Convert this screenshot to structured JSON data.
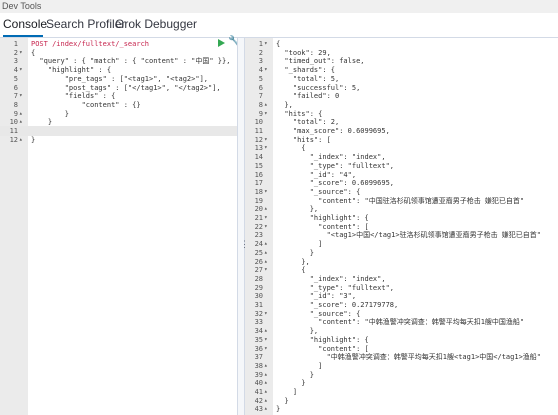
{
  "app": {
    "title": "Dev Tools"
  },
  "tabs": [
    {
      "label": "Console",
      "active": true
    },
    {
      "label": "Search Profiler",
      "active": false
    },
    {
      "label": "Grok Debugger",
      "active": false
    }
  ],
  "request": {
    "lines": [
      {
        "n": "1",
        "fold": "",
        "text": "POST /index/fulltext/_search",
        "method": true
      },
      {
        "n": "2",
        "fold": "▾",
        "text": "{"
      },
      {
        "n": "3",
        "fold": "",
        "text": "  \"query\" : { \"match\" : { \"content\" : \"中国\" }},"
      },
      {
        "n": "4",
        "fold": "▾",
        "text": "    \"highlight\" : {"
      },
      {
        "n": "5",
        "fold": "",
        "text": "        \"pre_tags\" : [\"<tag1>\", \"<tag2>\"],"
      },
      {
        "n": "6",
        "fold": "",
        "text": "        \"post_tags\" : [\"</tag1>\", \"</tag2>\"],"
      },
      {
        "n": "7",
        "fold": "▾",
        "text": "        \"fields\" : {"
      },
      {
        "n": "8",
        "fold": "",
        "text": "            \"content\" : {}"
      },
      {
        "n": "9",
        "fold": "▴",
        "text": "        }"
      },
      {
        "n": "10",
        "fold": "▴",
        "text": "    }"
      },
      {
        "n": "11",
        "fold": "",
        "text": "",
        "highlight": true
      },
      {
        "n": "12",
        "fold": "▴",
        "text": "}"
      }
    ]
  },
  "response": {
    "lines": [
      {
        "n": "1",
        "fold": "▾",
        "text": "{"
      },
      {
        "n": "2",
        "fold": "",
        "text": "  \"took\": 29,"
      },
      {
        "n": "3",
        "fold": "",
        "text": "  \"timed_out\": false,"
      },
      {
        "n": "4",
        "fold": "▾",
        "text": "  \"_shards\": {"
      },
      {
        "n": "5",
        "fold": "",
        "text": "    \"total\": 5,"
      },
      {
        "n": "6",
        "fold": "",
        "text": "    \"successful\": 5,"
      },
      {
        "n": "7",
        "fold": "",
        "text": "    \"failed\": 0"
      },
      {
        "n": "8",
        "fold": "▴",
        "text": "  },"
      },
      {
        "n": "9",
        "fold": "▾",
        "text": "  \"hits\": {"
      },
      {
        "n": "10",
        "fold": "",
        "text": "    \"total\": 2,"
      },
      {
        "n": "11",
        "fold": "",
        "text": "    \"max_score\": 0.6099695,"
      },
      {
        "n": "12",
        "fold": "▾",
        "text": "    \"hits\": ["
      },
      {
        "n": "13",
        "fold": "▾",
        "text": "      {"
      },
      {
        "n": "14",
        "fold": "",
        "text": "        \"_index\": \"index\","
      },
      {
        "n": "15",
        "fold": "",
        "text": "        \"_type\": \"fulltext\","
      },
      {
        "n": "16",
        "fold": "",
        "text": "        \"_id\": \"4\","
      },
      {
        "n": "17",
        "fold": "",
        "text": "        \"_score\": 0.6099695,"
      },
      {
        "n": "18",
        "fold": "▾",
        "text": "        \"_source\": {"
      },
      {
        "n": "19",
        "fold": "",
        "text": "          \"content\": \"中国驻洛杉矶领事馆遭亚裔男子枪击 嫌犯已自首\""
      },
      {
        "n": "20",
        "fold": "▴",
        "text": "        },"
      },
      {
        "n": "21",
        "fold": "▾",
        "text": "        \"highlight\": {"
      },
      {
        "n": "22",
        "fold": "▾",
        "text": "          \"content\": ["
      },
      {
        "n": "23",
        "fold": "",
        "text": "            \"<tag1>中国</tag1>驻洛杉矶领事馆遭亚裔男子枪击 嫌犯已自首\""
      },
      {
        "n": "24",
        "fold": "▴",
        "text": "          ]"
      },
      {
        "n": "25",
        "fold": "▴",
        "text": "        }"
      },
      {
        "n": "26",
        "fold": "▴",
        "text": "      },"
      },
      {
        "n": "27",
        "fold": "▾",
        "text": "      {"
      },
      {
        "n": "28",
        "fold": "",
        "text": "        \"_index\": \"index\","
      },
      {
        "n": "29",
        "fold": "",
        "text": "        \"_type\": \"fulltext\","
      },
      {
        "n": "30",
        "fold": "",
        "text": "        \"_id\": \"3\","
      },
      {
        "n": "31",
        "fold": "",
        "text": "        \"_score\": 0.27179778,"
      },
      {
        "n": "32",
        "fold": "▾",
        "text": "        \"_source\": {"
      },
      {
        "n": "33",
        "fold": "",
        "text": "          \"content\": \"中韩渔警冲突调查：韩警平均每天扣1艘中国渔船\""
      },
      {
        "n": "34",
        "fold": "▴",
        "text": "        },"
      },
      {
        "n": "35",
        "fold": "▾",
        "text": "        \"highlight\": {"
      },
      {
        "n": "36",
        "fold": "▾",
        "text": "          \"content\": ["
      },
      {
        "n": "37",
        "fold": "",
        "text": "            \"中韩渔警冲突调查：韩警平均每天扣1艘<tag1>中国</tag1>渔船\""
      },
      {
        "n": "38",
        "fold": "▴",
        "text": "          ]"
      },
      {
        "n": "39",
        "fold": "▴",
        "text": "        }"
      },
      {
        "n": "40",
        "fold": "▴",
        "text": "      }"
      },
      {
        "n": "41",
        "fold": "▴",
        "text": "    ]"
      },
      {
        "n": "42",
        "fold": "▴",
        "text": "  }"
      },
      {
        "n": "43",
        "fold": "▴",
        "text": "}"
      }
    ]
  },
  "icons": {
    "run": "play-icon",
    "settings": "wrench-icon"
  },
  "colors": {
    "accent": "#006bb4",
    "run": "#34a853",
    "method": "#c7254e",
    "gutter": "#ebebeb"
  }
}
